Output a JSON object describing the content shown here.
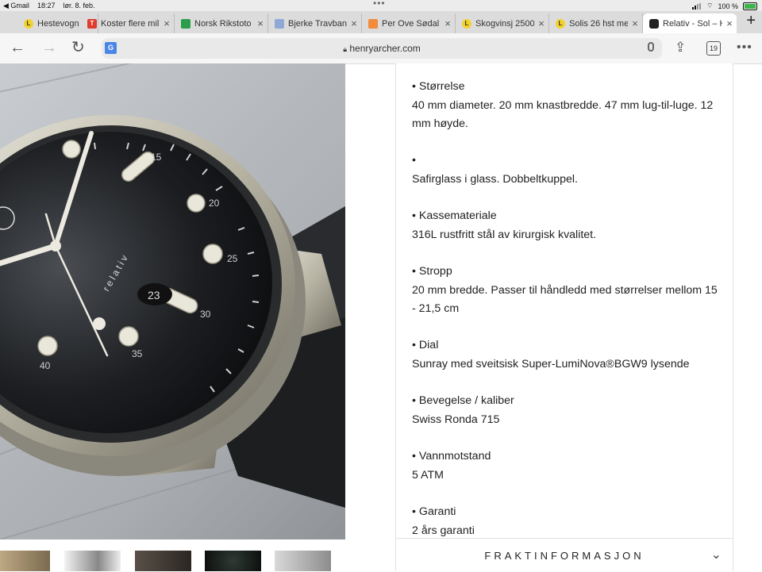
{
  "status": {
    "back_app": "◀ Gmail",
    "time": "18:27",
    "date": "lør. 8. feb.",
    "dots": "•••",
    "battery": "100 %"
  },
  "tabs": [
    {
      "label": "Hestevogn",
      "fav": "L",
      "fav_bg": "#f2d22e",
      "fav_fg": "#333"
    },
    {
      "label": "Koster flere mil",
      "fav": "T",
      "fav_bg": "#e03b2f",
      "fav_fg": "#fff"
    },
    {
      "label": "Norsk Rikstoto",
      "fav": "",
      "fav_bg": "#2a9d4a",
      "fav_fg": "#fff"
    },
    {
      "label": "Bjerke Travbane",
      "fav": "",
      "fav_bg": "#8fa9d6",
      "fav_fg": "#fff"
    },
    {
      "label": "Per Ove Sødal",
      "fav": "",
      "fav_bg": "#f28b3b",
      "fav_fg": "#fff"
    },
    {
      "label": "Skogvinsj 2500",
      "fav": "L",
      "fav_bg": "#f2d22e",
      "fav_fg": "#333"
    },
    {
      "label": "Solis 26 hst me",
      "fav": "L",
      "fav_bg": "#f2d22e",
      "fav_fg": "#333"
    },
    {
      "label": "Relativ - Sol – H",
      "fav": "",
      "fav_bg": "#222",
      "fav_fg": "#fff"
    }
  ],
  "toolbar": {
    "url": "henryarcher.com",
    "tab_count": "19",
    "translate_badge": "G"
  },
  "watch": {
    "brand": "relativ",
    "date": "23",
    "numbers": [
      "15",
      "20",
      "25",
      "30",
      "35",
      "40"
    ]
  },
  "specs": [
    {
      "heading": "• Størrelse",
      "text": "40 mm diameter. 20 mm knastbredde. 47 mm lug-til-luge. 12 mm høyde."
    },
    {
      "heading": "•",
      "text": "Safirglass i glass. Dobbeltkuppel."
    },
    {
      "heading": "• Kassemateriale",
      "text": "316L rustfritt stål av kirurgisk kvalitet."
    },
    {
      "heading": "• Stropp",
      "text": "20 mm bredde. Passer til håndledd med størrelser mellom 15 - 21,5 cm"
    },
    {
      "heading": "• Dial",
      "text": "Sunray med sveitsisk Super-LumiNova®BGW9 lysende"
    },
    {
      "heading": "• Bevegelse / kaliber",
      "text": "Swiss Ronda 715"
    },
    {
      "heading": "• Vannmotstand",
      "text": "5 ATM"
    },
    {
      "heading": "• Garanti",
      "text": "2 års garanti"
    }
  ],
  "accordion": {
    "label": "FRAKTINFORMASJON"
  }
}
